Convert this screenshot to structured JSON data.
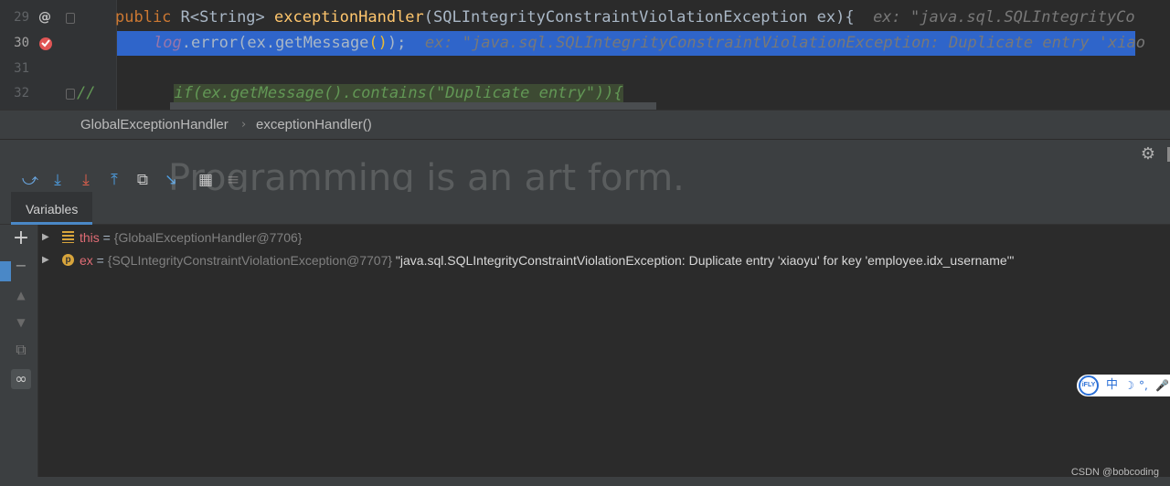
{
  "editor": {
    "lines": [
      {
        "number": "29",
        "gutter_icon": "@"
      },
      {
        "number": "30",
        "gutter_icon": "breakpoint"
      },
      {
        "number": "31"
      },
      {
        "number": "32"
      }
    ],
    "line29": {
      "kw": "public",
      "type": " R<String> ",
      "method": "exceptionHandler",
      "params": "(SQLIntegrityConstraintViolationException ex){",
      "hint": "  ex: \"java.sql.SQLIntegrityCo"
    },
    "line30": {
      "obj": "log",
      "call": ".error(ex.getMessage",
      "paren": "()",
      "end": ");",
      "hint": "  ex: \"java.sql.SQLIntegrityConstraintViolationException: Duplicate entry 'xiao"
    },
    "line32": {
      "comment_prefix": "//",
      "comment_body": "if(ex.getMessage().contains(\"Duplicate entry\")){"
    }
  },
  "breadcrumb": {
    "items": [
      "GlobalExceptionHandler",
      "exceptionHandler()"
    ],
    "separator": "›"
  },
  "watermark": "Programming is an art form.",
  "debug": {
    "tab_label": "Variables",
    "variables": [
      {
        "name": "this",
        "value": "{GlobalExceptionHandler@7706}",
        "icon": "field-icon"
      },
      {
        "name": "ex",
        "value": "{SQLIntegrityConstraintViolationException@7707}",
        "string": "\"java.sql.SQLIntegrityConstraintViolationException: Duplicate entry 'xiaoyu' for key 'employee.idx_username'\"",
        "icon": "param-icon",
        "icon_letter": "p"
      }
    ]
  },
  "ime": {
    "logo": "iFLY",
    "label": "中",
    "symbols": [
      "☽",
      "°,",
      "🎤"
    ]
  },
  "footer": {
    "credit": "CSDN @bobcoding"
  },
  "colors": {
    "selection": "#2f65ca",
    "keyword": "#cc7832",
    "method": "#ffc66d",
    "comment": "#629755",
    "variable_name": "#e06c75"
  }
}
